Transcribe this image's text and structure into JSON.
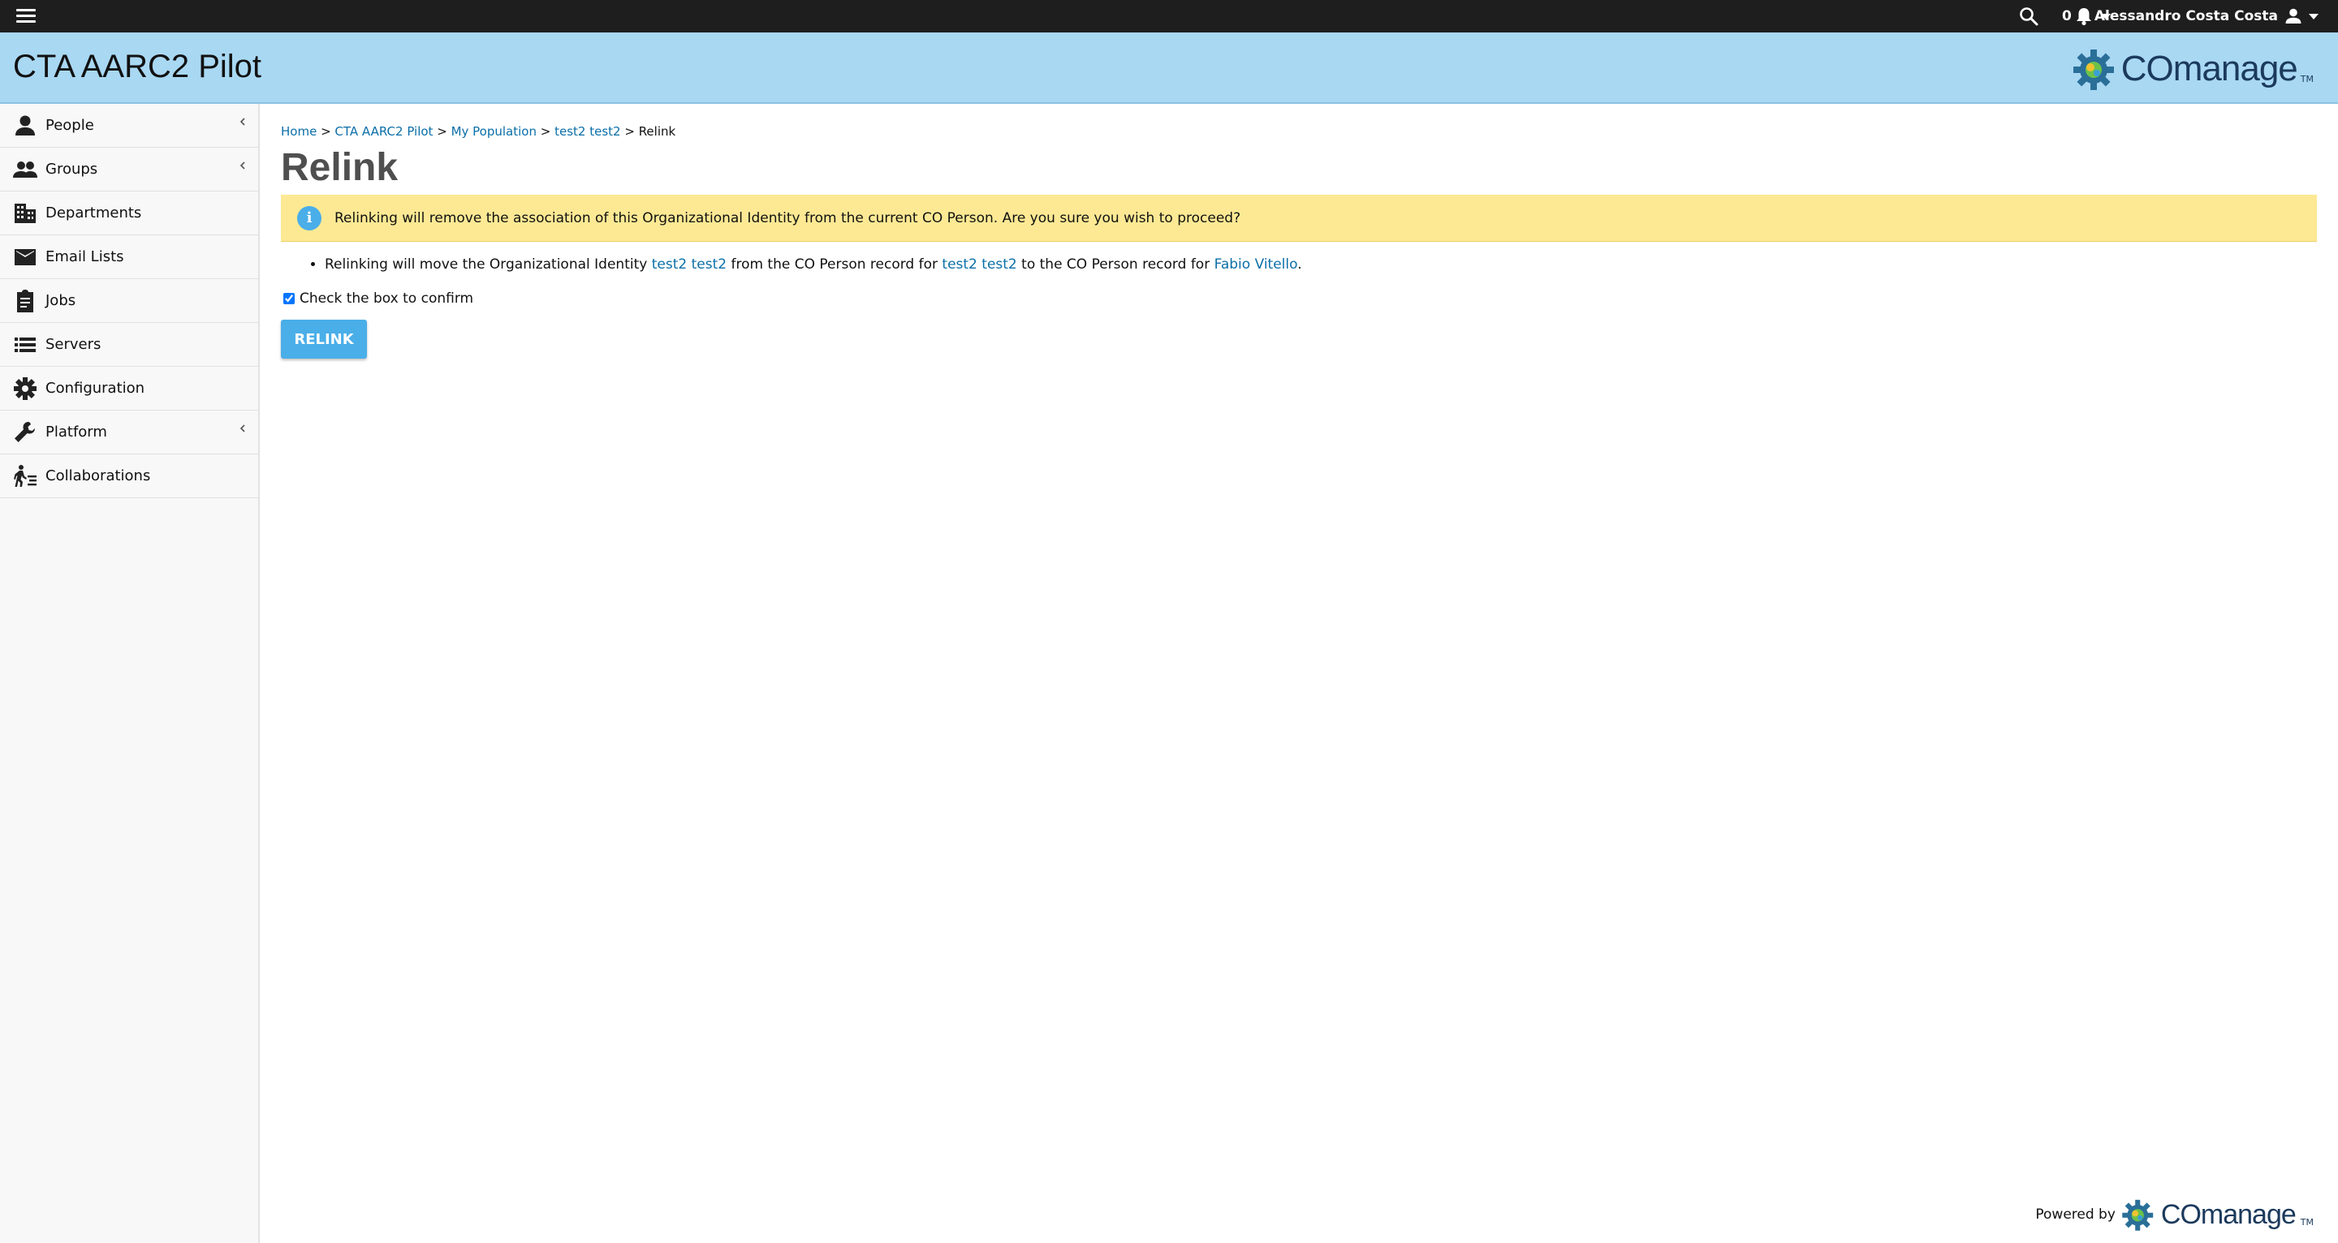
{
  "topbar": {
    "menu_icon": "hamburger-icon",
    "notification_count": "0",
    "user_name": "Alessandro Costa Costa"
  },
  "header": {
    "co_title": "CTA AARC2 Pilot",
    "logo_text": "COmanage",
    "logo_tm": "TM",
    "background": "#a9d8f3"
  },
  "sidebar": {
    "items": [
      {
        "label": "People",
        "icon": "person-icon",
        "expandable": true
      },
      {
        "label": "Groups",
        "icon": "groups-icon",
        "expandable": true
      },
      {
        "label": "Departments",
        "icon": "building-icon",
        "expandable": false
      },
      {
        "label": "Email Lists",
        "icon": "mail-icon",
        "expandable": false
      },
      {
        "label": "Jobs",
        "icon": "clipboard-icon",
        "expandable": false
      },
      {
        "label": "Servers",
        "icon": "list-icon",
        "expandable": false
      },
      {
        "label": "Configuration",
        "icon": "gear-icon",
        "expandable": false
      },
      {
        "label": "Platform",
        "icon": "wrench-icon",
        "expandable": true
      },
      {
        "label": "Collaborations",
        "icon": "collaborations-icon",
        "expandable": false
      }
    ]
  },
  "breadcrumb": {
    "items": [
      "Home",
      "CTA AARC2 Pilot",
      "My Population",
      "test2 test2"
    ],
    "separator": ">",
    "current": "Relink"
  },
  "page": {
    "title": "Relink",
    "notice": "Relinking will remove the association of this Organizational Identity from the current CO Person. Are you sure you wish to proceed?",
    "notice_color": "#fde994",
    "relink_text_1": "Relinking will move the Organizational Identity ",
    "org_identity_link": "test2 test2",
    "relink_text_2": " from the CO Person record for ",
    "from_person_link": "test2 test2",
    "relink_text_3": " to the CO Person record for ",
    "to_person_link": "Fabio Vitello",
    "relink_text_4": ".",
    "confirm_label": "Check the box to confirm",
    "confirm_checked": true,
    "relink_button": "RELINK",
    "accent": "#4aaee8",
    "link_color": "#0b6fa8"
  },
  "footer": {
    "powered_by": "Powered by",
    "logo_text": "COmanage",
    "logo_tm": "TM"
  }
}
